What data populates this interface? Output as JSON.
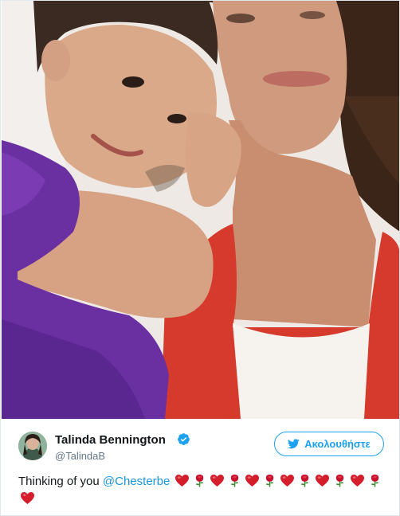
{
  "tweet": {
    "display_name": "Talinda Bennington",
    "handle": "@TalindaB",
    "verified": true,
    "follow_label": "Ακολουθήστε",
    "text_prefix": "Thinking of you ",
    "mention": "@Chesterbe",
    "emoji_sequence": [
      "heart",
      "rose",
      "heart",
      "rose",
      "heart",
      "rose",
      "heart",
      "rose",
      "heart",
      "rose",
      "heart",
      "rose",
      "heart"
    ],
    "media": {
      "type": "photo",
      "icon": "photo-image"
    }
  },
  "colors": {
    "brand_blue": "#1da1f2",
    "mention_blue": "#1b95e0",
    "secondary_text": "#657786",
    "heart_red": "#d41e2c",
    "rose_red": "#c8102e",
    "rose_stem": "#3d8b2f"
  }
}
